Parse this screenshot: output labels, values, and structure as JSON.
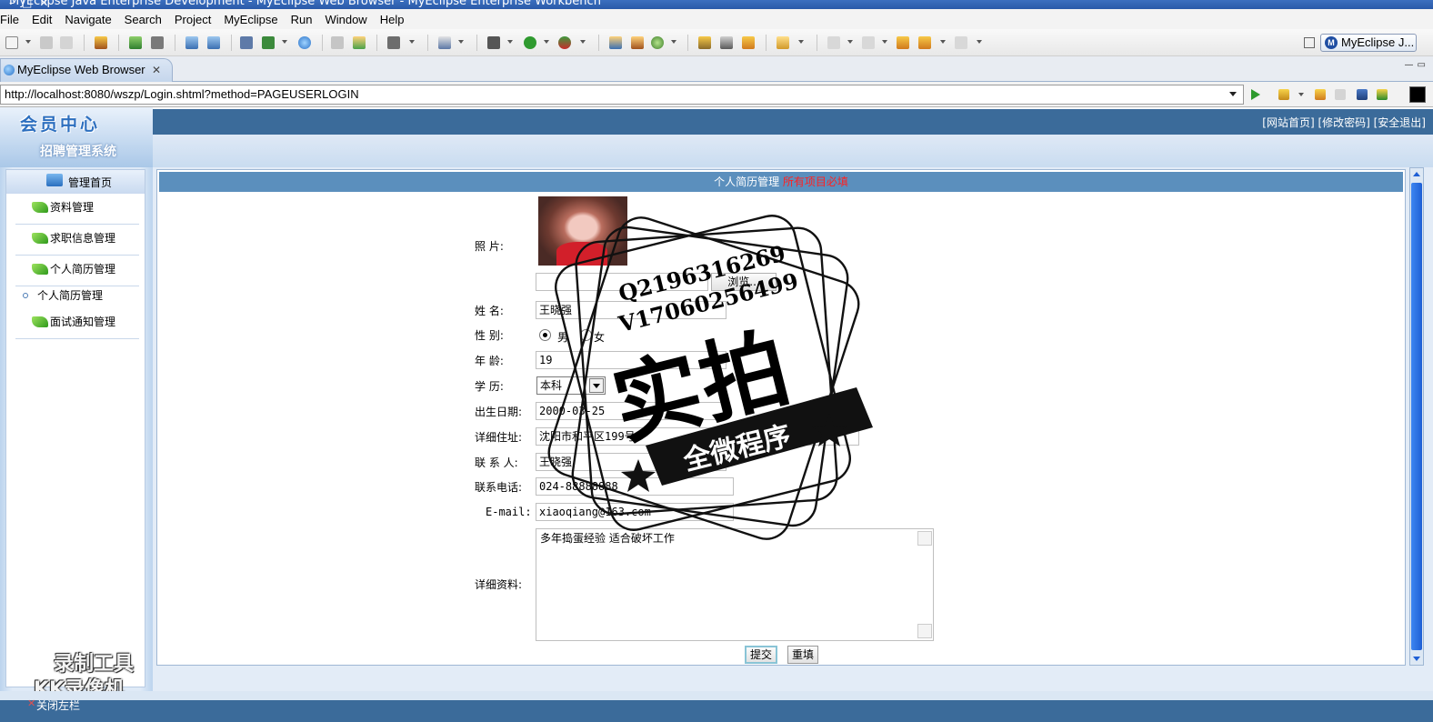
{
  "window": {
    "title": "MyEclipse Java Enterprise Development - MyEclipse Web Browser - MyEclipse Enterprise Workbench"
  },
  "menubar": [
    "File",
    "Edit",
    "Navigate",
    "Search",
    "Project",
    "MyEclipse",
    "Run",
    "Window",
    "Help"
  ],
  "toolbar": {
    "perspective_label": "MyEclipse J...",
    "perspective_badge": "M"
  },
  "editor": {
    "tab_label": "MyEclipse Web Browser",
    "tab_close": "✕",
    "url": "http://localhost:8080/wszp/Login.shtml?method=PAGEUSERLOGIN"
  },
  "site": {
    "logo_title": "会员中心",
    "logo_subtitle": "招聘管理系统",
    "header_links": "[网站首页] [修改密码] [安全退出]"
  },
  "sidebar": {
    "home": "管理首页",
    "items": [
      "资料管理",
      "求职信息管理",
      "个人简历管理",
      "面试通知管理"
    ],
    "sub_item": "个人简历管理",
    "watermark_line1": "录制工具",
    "watermark_line2": "KK录像机",
    "footer_close": "关闭左栏"
  },
  "form": {
    "header_title": "个人简历管理",
    "header_required": "所有项目必填",
    "labels": {
      "photo": "照      片:",
      "name": "姓      名:",
      "gender": "性      别:",
      "age": "年      龄:",
      "education": "学      历:",
      "birthday": "出生日期:",
      "address": "详细住址:",
      "contact": "联 系 人:",
      "phone": "联系电话:",
      "email": "E-mail:",
      "details": "详细资料:"
    },
    "browse_label": "浏览...",
    "values": {
      "name": "王晓强",
      "gender_male": "男",
      "gender_female": "女",
      "age": "19",
      "education": "本科",
      "birthday": "2000-03-25",
      "address": "沈阳市和平区199号",
      "contact": "王晓强",
      "phone": "024-88888888",
      "email": "xiaoqiang@163.com",
      "details": "多年捣蛋经验 适合破坏工作"
    },
    "submit_label": "提交",
    "reset_label": "重填"
  },
  "stamp": {
    "line_q": "Q2196316269",
    "line_v": "V17060256499",
    "big": "实拍",
    "banner": "全微程序"
  }
}
